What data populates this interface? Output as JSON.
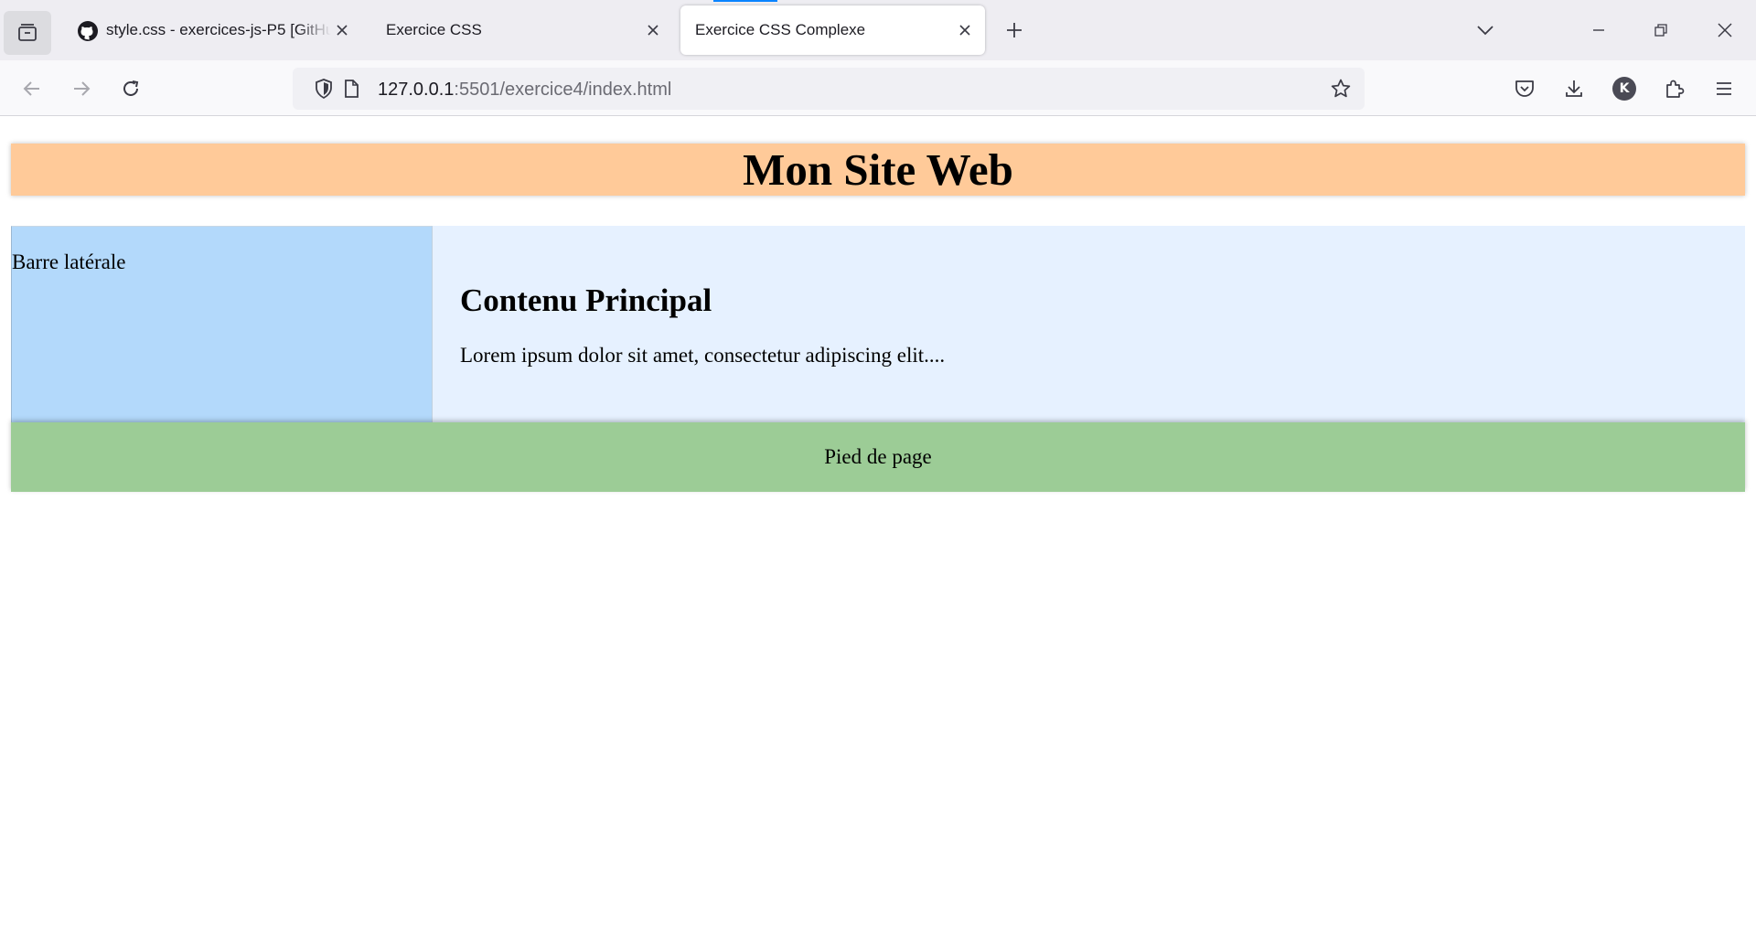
{
  "browser": {
    "tabs": [
      {
        "title": "style.css - exercices-js-P5 [GitHub]",
        "favicon": "github-icon",
        "active": false
      },
      {
        "title": "Exercice CSS",
        "active": false
      },
      {
        "title": "Exercice CSS Complexe",
        "active": true
      }
    ],
    "url": {
      "host": "127.0.0.1",
      "rest": ":5501/exercice4/index.html"
    },
    "profile_initial": "K",
    "accent_color": "#0a84ff"
  },
  "page": {
    "header_title": "Mon Site Web",
    "sidebar_text": "Barre latérale",
    "main_heading": "Contenu Principal",
    "main_paragraph": "Lorem ipsum dolor sit amet, consectetur adipiscing elit....",
    "footer_text": "Pied de page",
    "colors": {
      "header_bg": "#ffca99",
      "sidebar_bg": "#b3d9fb",
      "main_bg": "#e6f1ff",
      "footer_bg": "#9ccc96"
    }
  }
}
